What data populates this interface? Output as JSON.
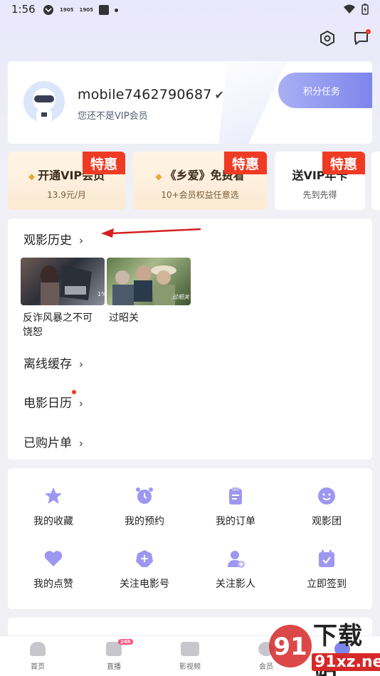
{
  "status_bar": {
    "time": "1:56",
    "left_icons": [
      "vpn-icon",
      "app-icon",
      "app-icon",
      "stop-icon",
      "dot-icon"
    ],
    "left_icon_texts": [
      "1905",
      "1905"
    ]
  },
  "header": {
    "icons": [
      "settings-icon",
      "message-icon"
    ]
  },
  "profile": {
    "username": "mobile7462790687",
    "verified_mark": "✔",
    "vip_status": "您还不是VIP会员",
    "points_button": "积分任务"
  },
  "promos": [
    {
      "title": "开通VIP会员",
      "subtitle": "13.9元/月",
      "badge": "特惠"
    },
    {
      "title": "《乡爱》免费看",
      "subtitle": "10+会员权益任意选",
      "badge": "特惠"
    },
    {
      "title": "送VIP年卡",
      "subtitle": "先到先得",
      "badge": "特惠"
    }
  ],
  "history": {
    "title": "观影历史",
    "chevron": "›",
    "items": [
      {
        "title": "反诈风暴之不可饶恕",
        "title_line1": "反诈风暴之不可",
        "title_line2": "饶恕",
        "overlay": "1%"
      },
      {
        "title": "过昭关",
        "overlay": "过昭关"
      }
    ]
  },
  "menu_rows": [
    {
      "label": "离线缓存",
      "chevron": "›"
    },
    {
      "label": "电影日历",
      "chevron": "›",
      "has_dot": true
    },
    {
      "label": "已购片单",
      "chevron": "›"
    }
  ],
  "grid": [
    {
      "label": "我的收藏",
      "icon": "star-icon"
    },
    {
      "label": "我的预约",
      "icon": "alarm-clock-icon"
    },
    {
      "label": "我的订单",
      "icon": "clipboard-icon"
    },
    {
      "label": "观影团",
      "icon": "smile-icon"
    },
    {
      "label": "我的点赞",
      "icon": "heart-icon"
    },
    {
      "label": "关注电影号",
      "icon": "plus-badge-icon"
    },
    {
      "label": "关注影人",
      "icon": "add-person-icon"
    },
    {
      "label": "立即签到",
      "icon": "calendar-check-icon"
    }
  ],
  "bottom_nav": [
    {
      "label": "首页",
      "icon": "home-icon"
    },
    {
      "label": "直播",
      "icon": "live-icon",
      "badge": "24h"
    },
    {
      "label": "影视频",
      "icon": "video-icon"
    },
    {
      "label": "会员",
      "icon": "member-icon"
    },
    {
      "label": "我的",
      "icon": "profile-icon"
    }
  ],
  "watermark": {
    "line1": "下载站",
    "line2": "91xz.net",
    "number": "91"
  },
  "colors": {
    "accent_purple": "#7d86ec",
    "badge_red": "#ef3b24",
    "icon_purple": "#9e97f2",
    "arrow_red": "#d42020"
  }
}
